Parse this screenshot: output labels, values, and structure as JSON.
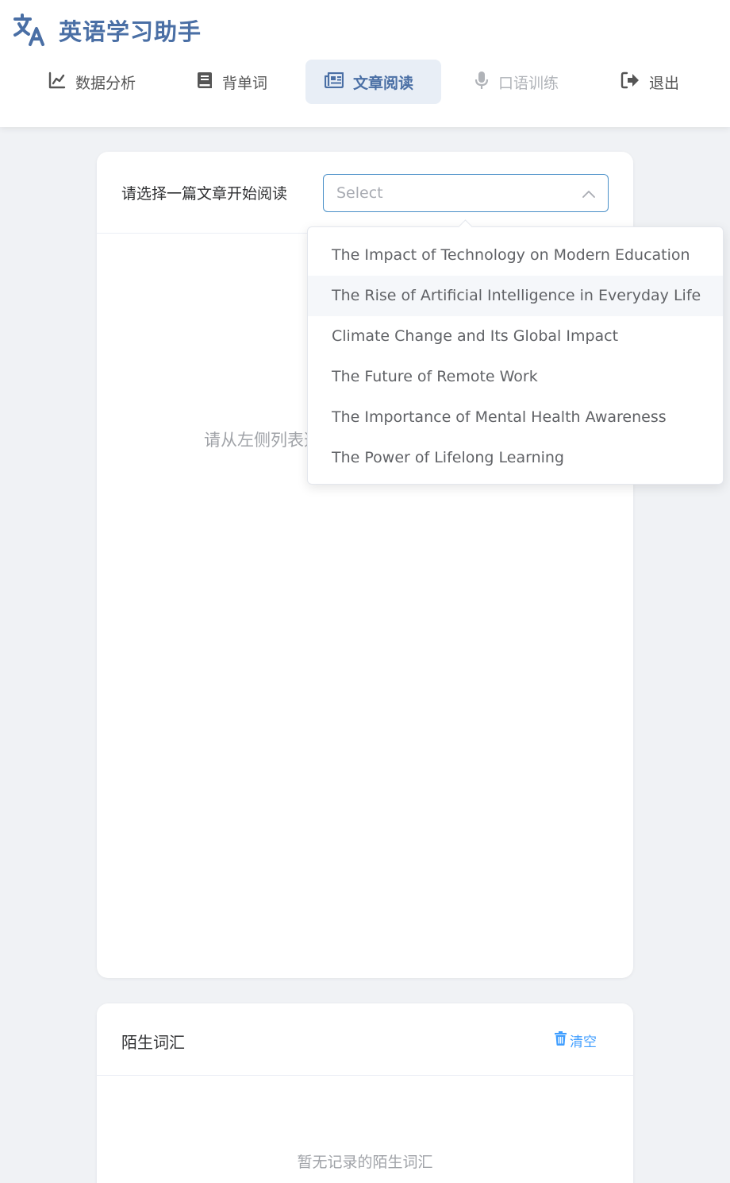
{
  "app": {
    "title": "英语学习助手",
    "logo_icon": "translate-icon",
    "brand_color": "#4a6fa5"
  },
  "nav": {
    "items": [
      {
        "label": "数据分析",
        "icon": "chart-line-icon",
        "state": "normal"
      },
      {
        "label": "背单词",
        "icon": "book-icon",
        "state": "normal"
      },
      {
        "label": "文章阅读",
        "icon": "newspaper-icon",
        "state": "active"
      },
      {
        "label": "口语训练",
        "icon": "microphone-icon",
        "state": "disabled"
      },
      {
        "label": "退出",
        "icon": "logout-icon",
        "state": "normal"
      }
    ]
  },
  "reader": {
    "select_label": "请选择一篇文章开始阅读",
    "select_placeholder": "Select",
    "empty_hint": "请从左侧列表选择一篇文章",
    "options": [
      "The Impact of Technology on Modern Education",
      "The Rise of Artificial Intelligence in Everyday Life",
      "Climate Change and Its Global Impact",
      "The Future of Remote Work",
      "The Importance of Mental Health Awareness",
      "The Power of Lifelong Learning"
    ],
    "hovered_option_index": 1
  },
  "vocab": {
    "title": "陌生词汇",
    "clear_label": "清空",
    "empty_text": "暂无记录的陌生词汇"
  },
  "colors": {
    "accent": "#409eff",
    "select_border": "#4a90c8",
    "active_nav_bg": "#e8eef6"
  }
}
